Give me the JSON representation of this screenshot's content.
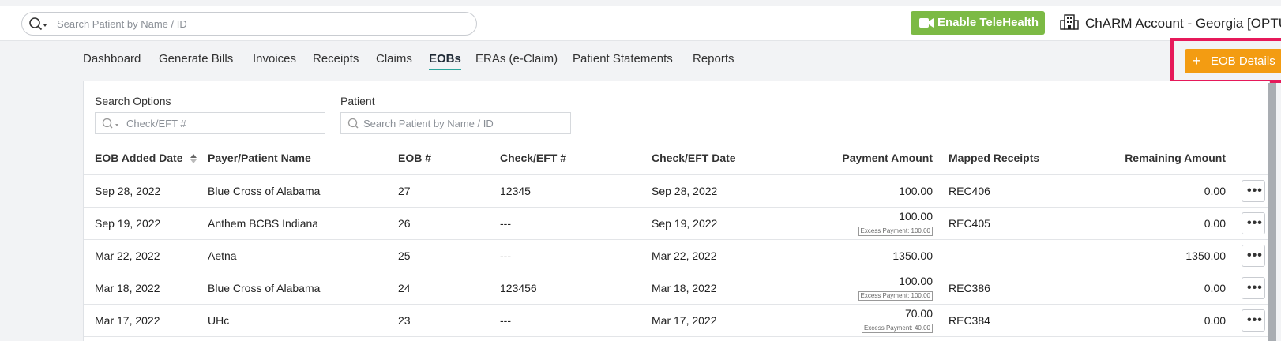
{
  "header": {
    "search_placeholder": "Search Patient by Name / ID",
    "telehealth_label": "Enable TeleHealth",
    "account_label": "ChARM Account - Georgia [OPTUM"
  },
  "nav": {
    "items": [
      {
        "label": "Dashboard"
      },
      {
        "label": "Generate Bills"
      },
      {
        "label": "Invoices"
      },
      {
        "label": "Receipts"
      },
      {
        "label": "Claims"
      },
      {
        "label": "EOBs"
      },
      {
        "label": "ERAs (e-Claim)"
      },
      {
        "label": "Patient Statements"
      },
      {
        "label": "Reports"
      }
    ],
    "active": "EOBs",
    "eob_details_label": "EOB Details"
  },
  "filters": {
    "search_options_label": "Search Options",
    "check_placeholder": "Check/EFT #",
    "patient_label": "Patient",
    "patient_placeholder": "Search Patient by Name / ID"
  },
  "table": {
    "columns": [
      "EOB Added Date",
      "Payer/Patient Name",
      "EOB #",
      "Check/EFT #",
      "Check/EFT Date",
      "Payment Amount",
      "Mapped Receipts",
      "Remaining Amount"
    ],
    "rows": [
      {
        "date": "Sep 28, 2022",
        "payer": "Blue Cross of Alabama",
        "eob": "27",
        "check": "12345",
        "check_date": "Sep 28, 2022",
        "payment": "100.00",
        "excess": "",
        "receipt": "REC406",
        "remaining": "0.00"
      },
      {
        "date": "Sep 19, 2022",
        "payer": "Anthem BCBS Indiana",
        "eob": "26",
        "check": "---",
        "check_date": "Sep 19, 2022",
        "payment": "100.00",
        "excess": "Excess Payment: 100.00",
        "receipt": "REC405",
        "remaining": "0.00"
      },
      {
        "date": "Mar 22, 2022",
        "payer": "Aetna",
        "eob": "25",
        "check": "---",
        "check_date": "Mar 22, 2022",
        "payment": "1350.00",
        "excess": "",
        "receipt": "",
        "remaining": "1350.00"
      },
      {
        "date": "Mar 18, 2022",
        "payer": "Blue Cross of Alabama",
        "eob": "24",
        "check": "123456",
        "check_date": "Mar 18, 2022",
        "payment": "100.00",
        "excess": "Excess Payment: 100.00",
        "receipt": "REC386",
        "remaining": "0.00"
      },
      {
        "date": "Mar 17, 2022",
        "payer": "UHc",
        "eob": "23",
        "check": "---",
        "check_date": "Mar 17, 2022",
        "payment": "70.00",
        "excess": "Excess Payment: 40.00",
        "receipt": "REC384",
        "remaining": "0.00"
      }
    ]
  },
  "colors": {
    "telehealth": "#7cba45",
    "eob_button": "#f39c12",
    "highlight": "#e6195a",
    "active_tab": "#2aa39a"
  }
}
